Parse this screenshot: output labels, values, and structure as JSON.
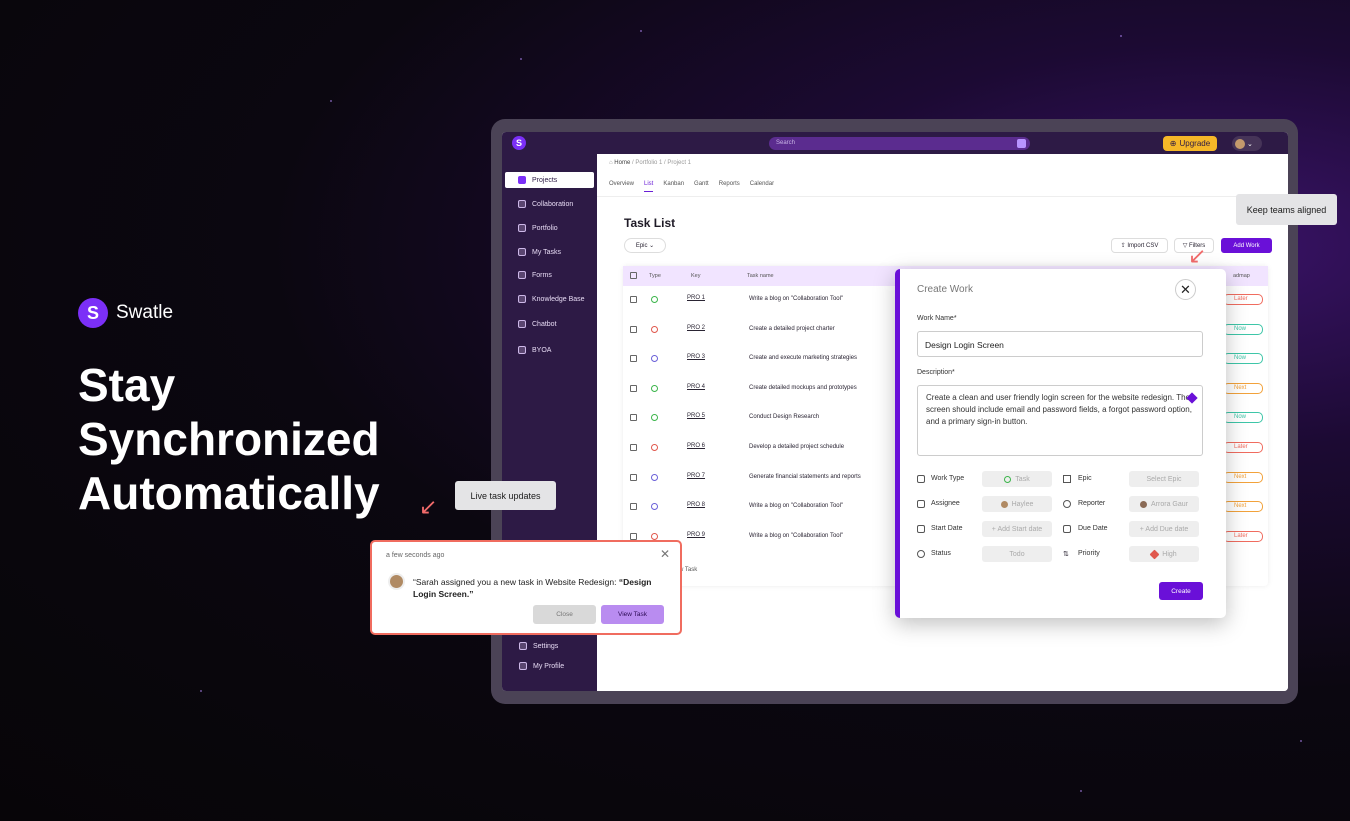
{
  "brand": {
    "logo_letter": "S",
    "name": "Swatle"
  },
  "headline": [
    "Stay",
    "Synchronized",
    "Automatically"
  ],
  "app": {
    "logo_letter": "S",
    "search_placeholder": "Search",
    "upgrade_label": "Upgrade",
    "sidebar": [
      {
        "label": "Projects",
        "icon": "projects-icon",
        "active": true
      },
      {
        "label": "Collaboration",
        "icon": "collaboration-icon"
      },
      {
        "label": "Portfolio",
        "icon": "portfolio-icon"
      },
      {
        "label": "My Tasks",
        "icon": "tasks-icon"
      },
      {
        "label": "Forms",
        "icon": "forms-icon"
      },
      {
        "label": "Knowledge Base",
        "icon": "knowledge-icon"
      },
      {
        "label": "Chatbot",
        "icon": "chatbot-icon"
      },
      {
        "label": "BYOA",
        "icon": "byoa-icon"
      }
    ],
    "sidebar_bottom": [
      {
        "label": "Settings",
        "icon": "settings-icon"
      },
      {
        "label": "My Profile",
        "icon": "profile-icon"
      }
    ],
    "breadcrumb": {
      "home": "Home",
      "rest": " / Portfolio 1 / Project 1"
    },
    "tabs": [
      "Overview",
      "List",
      "Kanban",
      "Gantt",
      "Reports",
      "Calendar"
    ],
    "active_tab": "List",
    "page_title": "Task List",
    "epic_filter": "Epic",
    "import_csv": "Import CSV",
    "filters": "Filters",
    "add_work": "Add Work",
    "table": {
      "headers": {
        "type": "Type",
        "key": "Key",
        "task_name": "Task name",
        "roadmap": "admap"
      },
      "rows": [
        {
          "key": "PRO 1",
          "name": "Write a blog on \"Collaboration Tool\"",
          "type_color": "#3bb54a",
          "status": "Later",
          "status_color": "#f06c5f"
        },
        {
          "key": "PRO 2",
          "name": "Create a detailed project charter",
          "type_color": "#e0574c",
          "status": "Now",
          "status_color": "#3ec6a8"
        },
        {
          "key": "PRO 3",
          "name": "Create and execute marketing strategies",
          "type_color": "#6a60d8",
          "status": "Now",
          "status_color": "#3ec6a8"
        },
        {
          "key": "PRO 4",
          "name": "Create detailed mockups and prototypes",
          "type_color": "#3bb54a",
          "status": "Next",
          "status_color": "#f2a23b"
        },
        {
          "key": "PRO 5",
          "name": "Conduct Design Research",
          "type_color": "#3bb54a",
          "status": "Now",
          "status_color": "#3ec6a8"
        },
        {
          "key": "PRO 6",
          "name": "Develop a detailed project schedule",
          "type_color": "#e0574c",
          "status": "Later",
          "status_color": "#f06c5f"
        },
        {
          "key": "PRO 7",
          "name": "Generate financial statements and reports",
          "type_color": "#6a60d8",
          "status": "Next",
          "status_color": "#f2a23b"
        },
        {
          "key": "PRO 8",
          "name": "Write a blog on \"Collaboration Tool\"",
          "type_color": "#6a60d8",
          "status": "Next",
          "status_color": "#f2a23b"
        },
        {
          "key": "PRO 9",
          "name": "Write a blog on \"Collaboration Tool\"",
          "type_color": "#e0574c",
          "status": "Later",
          "status_color": "#f06c5f"
        }
      ],
      "new_task": "w Task"
    }
  },
  "modal": {
    "title": "Create Work",
    "work_name_label": "Work Name*",
    "work_name_value": "Design Login Screen",
    "description_label": "Description*",
    "description_value": "Create a clean and user friendly login screen for the website redesign. The screen should include email and password fields, a forgot password option, and a primary sign-in button.",
    "fields": {
      "work_type": {
        "label": "Work Type",
        "value": "Task"
      },
      "epic": {
        "label": "Epic",
        "value": "Select Epic"
      },
      "assignee": {
        "label": "Assignee",
        "value": "Haylee"
      },
      "reporter": {
        "label": "Reporter",
        "value": "Arrora Gaur"
      },
      "start_date": {
        "label": "Start Date",
        "value": "+ Add Start date"
      },
      "due_date": {
        "label": "Due Date",
        "value": "+ Add Due date"
      },
      "status": {
        "label": "Status",
        "value": "Todo"
      },
      "priority": {
        "label": "Priority",
        "value": "High"
      }
    },
    "create_label": "Create"
  },
  "tooltips": {
    "keep_aligned": "Keep teams aligned",
    "live_updates": "Live task updates"
  },
  "notification": {
    "time": "a few seconds ago",
    "message_prefix": "“Sarah assigned you a new task in Website Redesign: ",
    "message_bold": "“Design Login Screen.”",
    "close_label": "Close",
    "view_label": "View Task"
  }
}
